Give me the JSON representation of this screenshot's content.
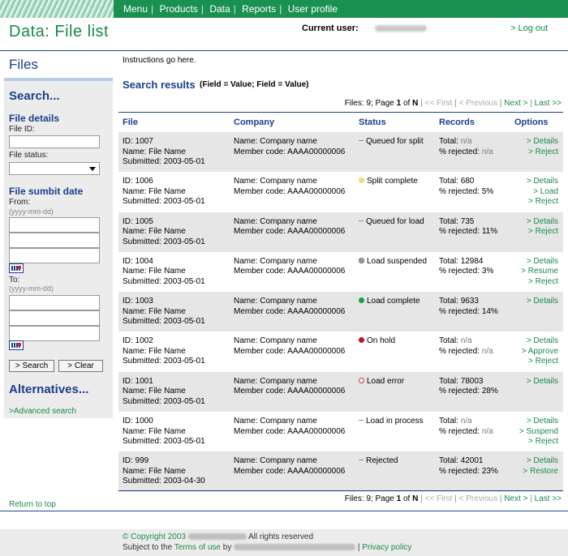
{
  "nav": [
    "Menu",
    "Products",
    "Data",
    "Reports",
    "User profile"
  ],
  "header": {
    "title": "Data: File list",
    "current_user_label": "Current user:",
    "logout": "> Log out"
  },
  "sidebar": {
    "files_title": "Files",
    "search_title": "Search...",
    "file_details": "File details",
    "file_id_label": "File ID:",
    "file_status_label": "File status:",
    "submit_date_title": "File sumbit date",
    "from_label": "From:",
    "to_label": "To:",
    "date_hint": "(yyyy-mm-dd)",
    "search_button": "> Search",
    "clear_button": "> Clear",
    "alternatives_title": "Alternatives...",
    "advanced_search": ">Advanced search"
  },
  "main": {
    "instructions": "Instructions go here.",
    "results_title": "Search results",
    "results_sub": "(Field = Value; Field = Value)",
    "pager": {
      "info_prefix": "Files: 9; Page ",
      "page": "1",
      "info_mid": " of ",
      "pages": "N",
      "first": "<< First",
      "previous": "< Previous",
      "next": "Next >",
      "last": "Last >>"
    },
    "columns": [
      "File",
      "Company",
      "Status",
      "Records",
      "Options"
    ]
  },
  "rows": [
    {
      "id": "ID: 1007",
      "name": "Name: File Name",
      "submitted": "Submitted: 2003-05-01",
      "company": "Name: Company name",
      "member": "Member code: AAAA00000006",
      "status": "Queued for split",
      "status_icon": "dash",
      "total": "Total: ",
      "total_val": "n/a",
      "rejected": "% rejected: ",
      "rejected_val": "n/a",
      "options": [
        "> Details",
        "> Reject"
      ]
    },
    {
      "id": "ID: 1006",
      "name": "Name: File Name",
      "submitted": "Submitted: 2003-05-01",
      "company": "Name: Company name",
      "member": "Member code: AAAA00000006",
      "status": "Split complete",
      "status_icon": "yellow",
      "total": "Total: ",
      "total_val": "680",
      "rejected": "% rejected: ",
      "rejected_val": "5%",
      "options": [
        "> Details",
        "> Load",
        "> Reject"
      ]
    },
    {
      "id": "ID: 1005",
      "name": "Name: File Name",
      "submitted": "Submitted: 2003-05-01",
      "company": "Name: Company name",
      "member": "Member code: AAAA00000006",
      "status": "Queued for load",
      "status_icon": "dash",
      "total": "Total: ",
      "total_val": "735",
      "rejected": "% rejected: ",
      "rejected_val": "11%",
      "options": [
        "> Details",
        "> Reject"
      ]
    },
    {
      "id": "ID: 1004",
      "name": "Name: File Name",
      "submitted": "Submitted: 2003-05-01",
      "company": "Name: Company name",
      "member": "Member code: AAAA00000006",
      "status": "Load suspended",
      "status_icon": "x",
      "total": "Total: ",
      "total_val": "12984",
      "rejected": "% rejected: ",
      "rejected_val": "3%",
      "options": [
        "> Details",
        "> Resume",
        "> Reject"
      ]
    },
    {
      "id": "ID: 1003",
      "name": "Name: File Name",
      "submitted": "Submitted: 2003-05-01",
      "company": "Name: Company name",
      "member": "Member code: AAAA00000006",
      "status": "Load complete",
      "status_icon": "green",
      "total": "Total: ",
      "total_val": "9633",
      "rejected": "% rejected: ",
      "rejected_val": "14%",
      "options": [
        "> Details"
      ]
    },
    {
      "id": "ID: 1002",
      "name": "Name: File Name",
      "submitted": "Submitted: 2003-05-01",
      "company": "Name: Company name",
      "member": "Member code: AAAA00000006",
      "status": "On hold",
      "status_icon": "red",
      "total": "Total: ",
      "total_val": "n/a",
      "rejected": "% rejected: ",
      "rejected_val": "n/a",
      "options": [
        "> Details",
        "> Approve",
        "> Reject"
      ]
    },
    {
      "id": "ID: 1001",
      "name": "Name: File Name",
      "submitted": "Submitted: 2003-05-01",
      "company": "Name: Company name",
      "member": "Member code: AAAA00000006",
      "status": "Load error",
      "status_icon": "ring",
      "total": "Total: ",
      "total_val": "78003",
      "rejected": "% rejected: ",
      "rejected_val": "28%",
      "options": [
        "> Details"
      ]
    },
    {
      "id": "ID: 1000",
      "name": "Name: File Name",
      "submitted": "Submitted: 2003-05-01",
      "company": "Name: Company name",
      "member": "Member code: AAAA00000006",
      "status": "Load in process",
      "status_icon": "dash",
      "total": "Total: ",
      "total_val": "n/a",
      "rejected": "% rejected: ",
      "rejected_val": "n/a",
      "options": [
        "> Details",
        "> Suspend",
        "> Reject"
      ]
    },
    {
      "id": "ID: 999",
      "name": "Name: File Name",
      "submitted": "Submitted: 2003-04-30",
      "company": "Name: Company name",
      "member": "Member code: AAAA00000006",
      "status": "Rejected",
      "status_icon": "dash",
      "total": "Total: ",
      "total_val": "42001",
      "rejected": "% rejected: ",
      "rejected_val": "23%",
      "options": [
        "> Details",
        "> Restore"
      ]
    }
  ],
  "footer": {
    "return_top": "Return to top",
    "copyright_prefix": "© Copyright 2003",
    "copyright_suffix": "All rights reserved",
    "subject_prefix": "Subject to the ",
    "terms": "Terms of use",
    "by": " by ",
    "separator": " | ",
    "privacy": "Privacy policy"
  },
  "colors": {
    "accent_green": "#1a9150",
    "heading_blue": "#1b3f8a",
    "link_green": "#1a8a4a"
  }
}
